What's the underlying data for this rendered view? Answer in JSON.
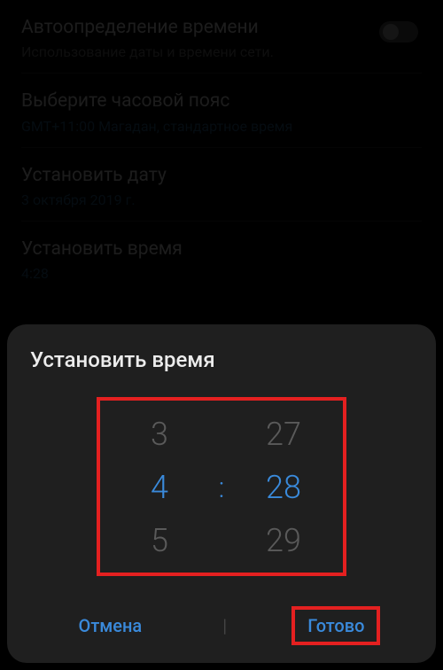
{
  "settings": {
    "autoTime": {
      "title": "Автоопределение времени",
      "subtitle": "Использование даты и времени сети."
    },
    "timezone": {
      "title": "Выберите часовой пояс",
      "subtitle": "GMT+11:00 Магадан, стандартное время"
    },
    "date": {
      "title": "Установить дату",
      "subtitle": "3 октября 2019 г."
    },
    "time": {
      "title": "Установить время",
      "subtitle": "4:28"
    }
  },
  "dialog": {
    "title": "Установить время",
    "picker": {
      "hourPrev": "3",
      "hour": "4",
      "hourNext": "5",
      "separator": ":",
      "minutePrev": "27",
      "minute": "28",
      "minuteNext": "29"
    },
    "cancel": "Отмена",
    "done": "Готово",
    "divider": "|"
  }
}
